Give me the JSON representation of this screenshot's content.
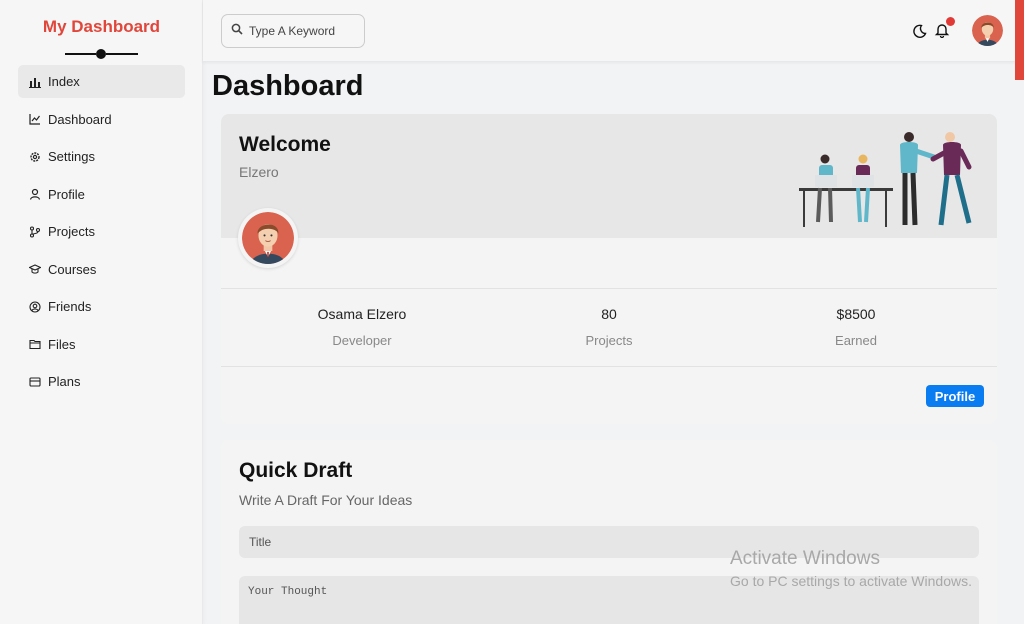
{
  "brand": {
    "title": "My Dashboard",
    "accent": "#e1463a"
  },
  "sidebar": {
    "items": [
      {
        "label": "Index",
        "icon": "bar-chart-icon",
        "active": true
      },
      {
        "label": "Dashboard",
        "icon": "line-chart-icon"
      },
      {
        "label": "Settings",
        "icon": "gear-icon"
      },
      {
        "label": "Profile",
        "icon": "user-icon"
      },
      {
        "label": "Projects",
        "icon": "diagram-icon"
      },
      {
        "label": "Courses",
        "icon": "graduation-cap-icon"
      },
      {
        "label": "Friends",
        "icon": "user-circle-icon"
      },
      {
        "label": "Files",
        "icon": "folder-icon"
      },
      {
        "label": "Plans",
        "icon": "credit-card-icon"
      }
    ]
  },
  "header": {
    "search_placeholder": "Type A Keyword",
    "icons": [
      "moon-icon",
      "bell-icon"
    ],
    "notification_dot_color": "#e13a36"
  },
  "main": {
    "title": "Dashboard"
  },
  "welcome": {
    "title": "Welcome",
    "subtitle": "Elzero",
    "stats": [
      {
        "value": "Osama Elzero",
        "label": "Developer"
      },
      {
        "value": "80",
        "label": "Projects"
      },
      {
        "value": "$8500",
        "label": "Earned"
      }
    ],
    "button": "Profile",
    "button_color": "#0a7cf2"
  },
  "draft": {
    "title": "Quick Draft",
    "subtitle": "Write A Draft For Your Ideas",
    "title_placeholder": "Title",
    "thought_placeholder": "Your Thought"
  },
  "watermark": {
    "line1": "Activate Windows",
    "line2": "Go to PC settings to activate Windows."
  }
}
